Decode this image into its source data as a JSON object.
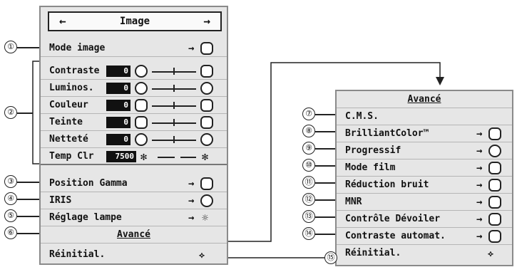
{
  "left_menu": {
    "title": "Image",
    "rows": [
      {
        "label": "Mode image"
      },
      {
        "label": "Contraste",
        "value": "0"
      },
      {
        "label": "Luminos.",
        "value": "0"
      },
      {
        "label": "Couleur",
        "value": "0"
      },
      {
        "label": "Teinte",
        "value": "0"
      },
      {
        "label": "Netteté",
        "value": "0"
      },
      {
        "label": "Temp Clr",
        "value": "7500"
      },
      {
        "label": "Position Gamma"
      },
      {
        "label": "IRIS"
      },
      {
        "label": "Réglage lampe"
      },
      {
        "label": "Avancé"
      },
      {
        "label": "Réinitial."
      }
    ]
  },
  "right_menu": {
    "title": "Avancé",
    "rows": [
      {
        "label": "C.M.S."
      },
      {
        "label": "BrilliantColor™"
      },
      {
        "label": "Progressif"
      },
      {
        "label": "Mode film"
      },
      {
        "label": "Réduction bruit"
      },
      {
        "label": "MNR"
      },
      {
        "label": "Contrôle Dévoiler"
      },
      {
        "label": "Contraste automat."
      },
      {
        "label": "Réinitial."
      }
    ]
  },
  "callouts": [
    "①",
    "②",
    "③",
    "④",
    "⑤",
    "⑥",
    "⑦",
    "⑧",
    "⑨",
    "⑩",
    "⑪",
    "⑫",
    "⑬",
    "⑭",
    "⑮"
  ],
  "symbols": {
    "arrow_left": "←",
    "arrow_right": "→",
    "reset": "⟡"
  }
}
